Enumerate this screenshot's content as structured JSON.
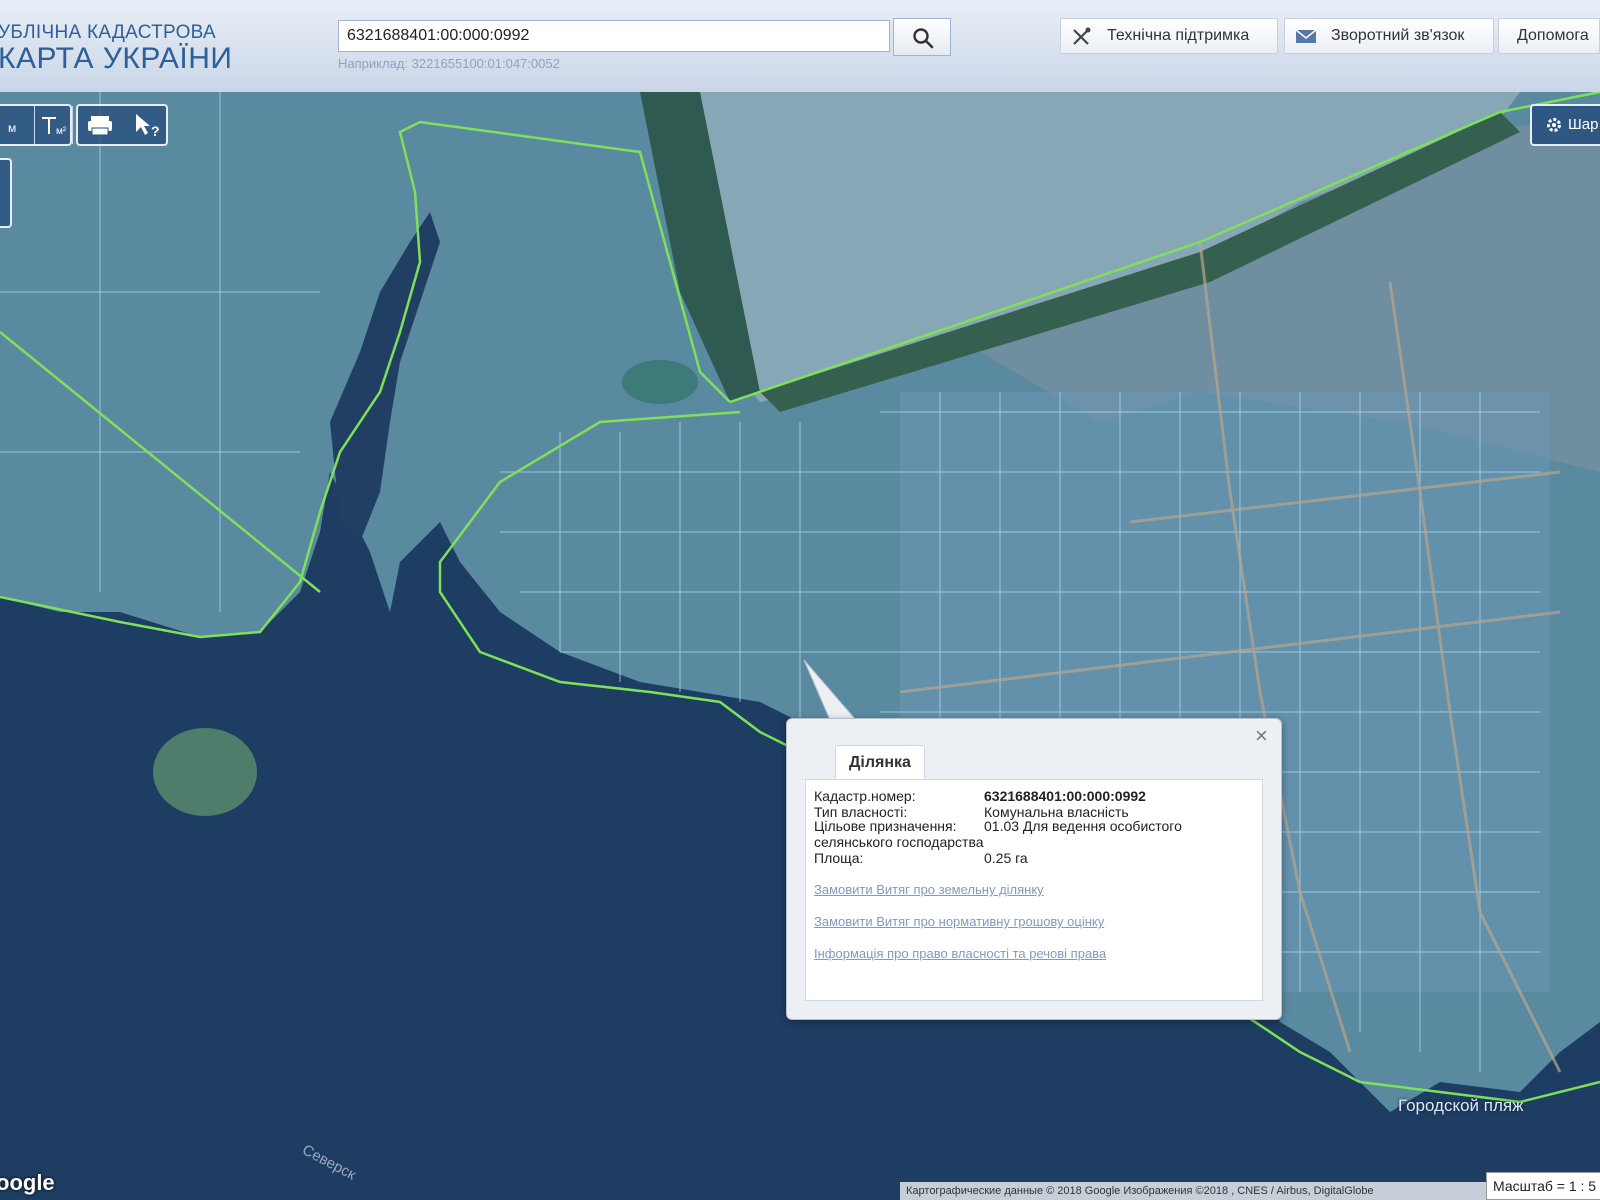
{
  "header": {
    "logo_line1": "УБЛІЧНА КАДАСТРОВА",
    "logo_line2": "КАРТА УКРАЇНИ",
    "search_value": "6321688401:00:000:0992",
    "search_hint": "Наприклад: 3221655100:01:047:0052",
    "support_label": "Технічна підтримка",
    "feedback_label": "Зворотний зв'язок",
    "help_label": "Допомога"
  },
  "map": {
    "layers_label": "Шар",
    "place_labels": [
      "Городской пляж",
      "Северск"
    ]
  },
  "popup": {
    "tab": "Ділянка",
    "fields": {
      "cadnum_label": "Кадастр.номер:",
      "cadnum_value": "6321688401:00:000:0992",
      "ownership_label": "Тип власності:",
      "ownership_value": "Комунальна власність",
      "purpose_label": "Цільове призначення:",
      "purpose_value_line1": "01.03 Для ведення особистого",
      "purpose_value_line2": "селянського господарства",
      "area_label": "Площа:",
      "area_value": "0.25 га"
    },
    "links": [
      "Замовити Витяг про земельну ділянку",
      "Замовити Витяг про нормативну грошову оцінку",
      "Інформація про право власності та речові права"
    ]
  },
  "footer": {
    "google": "oogle",
    "attribution": "Картографические данные © 2018 Google Изображения ©2018 , CNES / Airbus, DigitalGlobe",
    "scale": "Масштаб = 1 : 5"
  },
  "colors": {
    "water": "#1e3d62",
    "land": "#5f8fa6",
    "boundary": "#7fe05a",
    "parcel": "#9fd2ee"
  }
}
